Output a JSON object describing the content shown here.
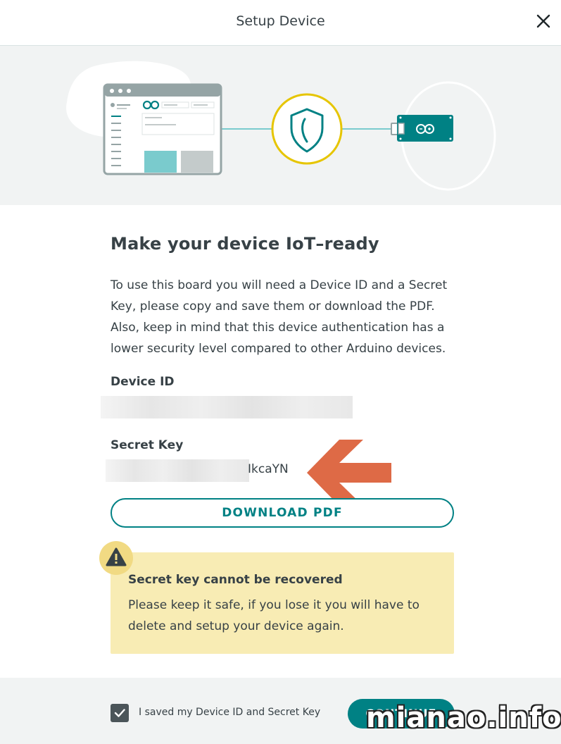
{
  "header": {
    "title": "Setup Device",
    "close_icon": "close-icon"
  },
  "hero": {
    "icons": [
      "browser-window-illustration",
      "shield-icon",
      "arduino-board-icon"
    ],
    "colors": {
      "teal": "#008184",
      "yellow_ring": "#e6c500",
      "light_teal": "#7acbcd"
    }
  },
  "main": {
    "heading": "Make your device IoT–ready",
    "intro_lines": [
      "To use this board you will need a Device ID and a Secret",
      "Key, please copy and save them or download the PDF.",
      "Also, keep in mind that this device authentication has a",
      "lower security level compared to other Arduino devices."
    ],
    "device_id_label": "Device ID",
    "secret_key_label": "Secret Key",
    "secret_key_visible_tail": "IkcaYN",
    "download_label": "DOWNLOAD PDF"
  },
  "warning": {
    "icon": "warning-icon",
    "title": "Secret key cannot be recovered",
    "lines": [
      "Please keep it safe, if you lose it you will have to",
      "delete and setup your device again."
    ]
  },
  "footer": {
    "checkbox_label": "I saved my Device ID and Secret Key",
    "checkbox_checked": true,
    "continue_label": "CONTINUE"
  },
  "watermark": "mianao.info"
}
